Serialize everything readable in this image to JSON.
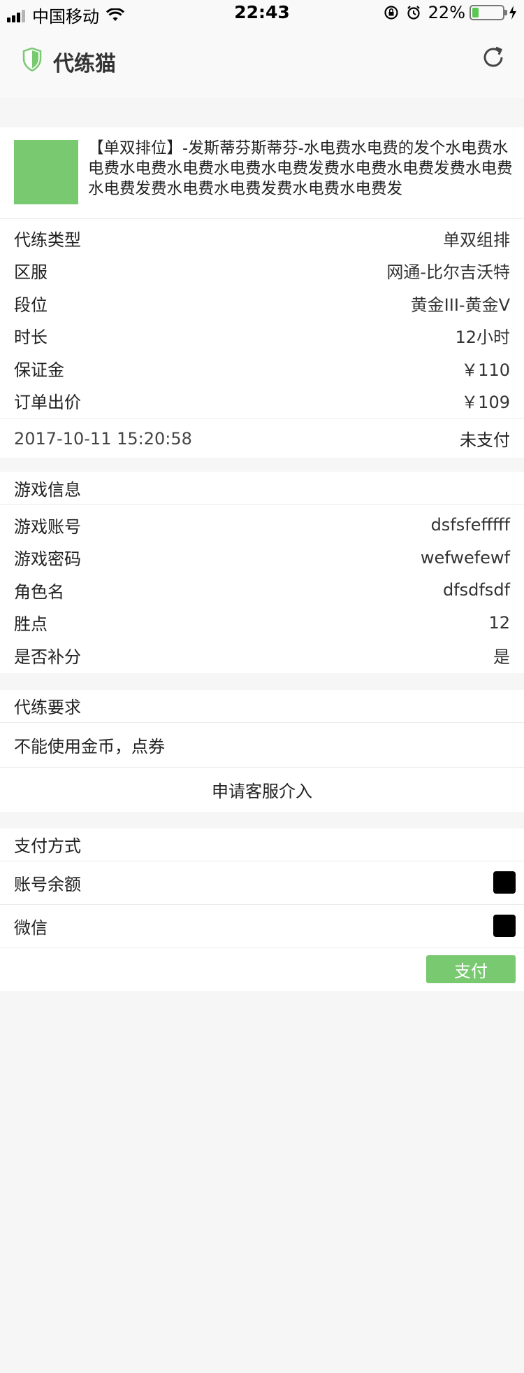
{
  "status_bar": {
    "carrier": "中国移动",
    "time": "22:43",
    "battery_percent": "22%",
    "battery_level": 0.22
  },
  "header": {
    "title": "代练猫",
    "accent_color": "#79c971"
  },
  "order": {
    "title": "【单双排位】-发斯蒂芬斯蒂芬-水电费水电费的发个水电费水电费水电费水电费水电费水电费发费水电费水电费发费水电费水电费发费水电费水电费发费水电费水电费发",
    "details": [
      {
        "label": "代练类型",
        "value": "单双组排"
      },
      {
        "label": "区服",
        "value": "网通-比尔吉沃特"
      },
      {
        "label": "段位",
        "value": "黄金III-黄金V"
      },
      {
        "label": "时长",
        "value": "12小时"
      },
      {
        "label": "保证金",
        "value": "￥110"
      },
      {
        "label": "订单出价",
        "value": "￥109"
      }
    ],
    "created_at": "2017-10-11 15:20:58",
    "status": "未支付"
  },
  "game_info": {
    "title": "游戏信息",
    "items": [
      {
        "label": "游戏账号",
        "value": "dsfsfefffff"
      },
      {
        "label": "游戏密码",
        "value": "wefwefewf"
      },
      {
        "label": "角色名",
        "value": "dfsdfsdf"
      },
      {
        "label": "胜点",
        "value": "12"
      },
      {
        "label": "是否补分",
        "value": "是"
      }
    ]
  },
  "requirements": {
    "title": "代练要求",
    "text": "不能使用金币，点券",
    "service_label": "申请客服介入"
  },
  "payment": {
    "title": "支付方式",
    "options": [
      {
        "label": "账号余额"
      },
      {
        "label": "微信"
      }
    ],
    "pay_label": "支付"
  }
}
